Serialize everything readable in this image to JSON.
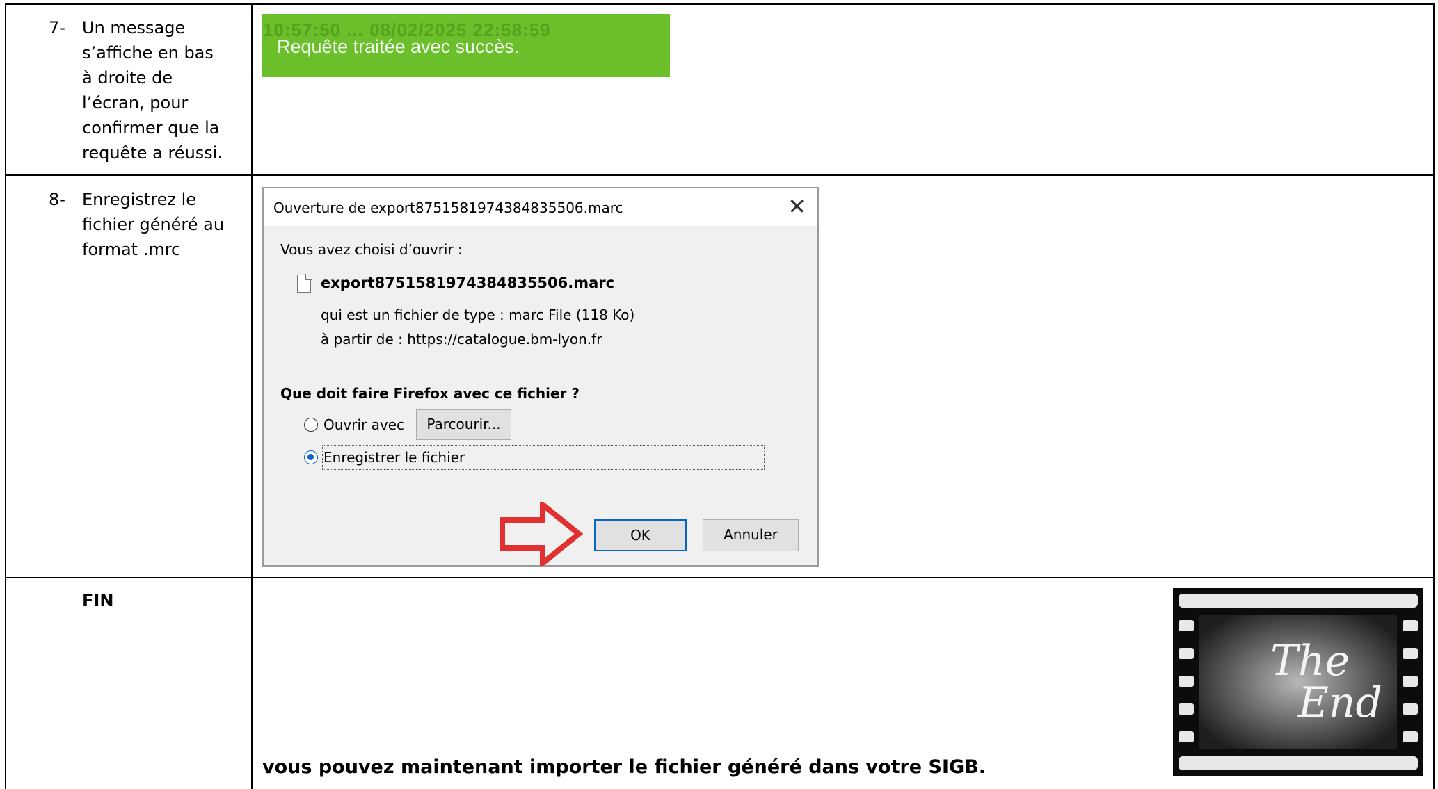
{
  "rows": [
    {
      "number": "7-",
      "text": "Un message s’affiche en bas à droite de l’écran, pour confirmer que la requête a réussi."
    },
    {
      "number": "8-",
      "text": "Enregistrez le fichier généré au format .mrc"
    },
    {
      "label": "FIN",
      "bottom_text": "vous pouvez maintenant importer le fichier généré dans votre SIGB."
    }
  ],
  "toast": {
    "message": "Requête traitée avec succès.",
    "background_text": "10:57:50 ... 08/02/2025 22:58:59",
    "color": "#6abf2a"
  },
  "dialog": {
    "title": "Ouverture de export8751581974384835506.marc",
    "close_icon": "close-icon",
    "intro": "Vous avez choisi d’ouvrir :",
    "filename": "export8751581974384835506.marc",
    "type_line": "qui est un fichier de type :  marc File (118 Ko)",
    "from_line": "à partir de :  https://catalogue.bm-lyon.fr",
    "question": "Que doit faire Firefox avec ce fichier ?",
    "option_open": "Ouvrir avec",
    "browse_button": "Parcourir...",
    "option_save": "Enregistrer le fichier",
    "selected_option": "Enregistrer le fichier",
    "ok_button": "OK",
    "cancel_button": "Annuler"
  },
  "annotations": {
    "arrow_icon": "red-arrow-icon",
    "arrow_color": "#e03030"
  },
  "film_image": {
    "text_line1": "The",
    "text_line2": "End"
  }
}
